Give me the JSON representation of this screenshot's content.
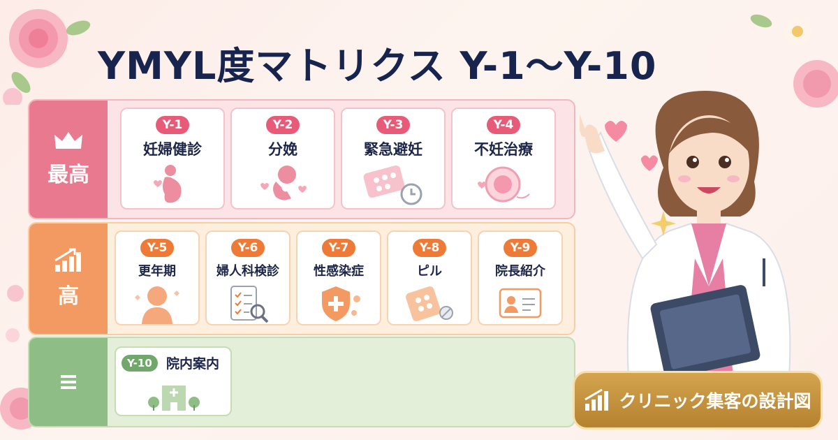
{
  "title": "YMYL度マトリクス Y-1〜Y-10",
  "tiers": {
    "highest": {
      "label": "最高",
      "icon": "crown-icon"
    },
    "high": {
      "label": "高",
      "icon": "rising-bars-icon"
    },
    "medium": {
      "label": "",
      "icon": "equals-icon"
    }
  },
  "cards": {
    "y1": {
      "code": "Y-1",
      "label": "妊婦健診",
      "icon": "pregnant-woman-icon"
    },
    "y2": {
      "code": "Y-2",
      "label": "分娩",
      "icon": "baby-icon"
    },
    "y3": {
      "code": "Y-3",
      "label": "緊急避妊",
      "icon": "pill-pack-clock-icon"
    },
    "y4": {
      "code": "Y-4",
      "label": "不妊治療",
      "icon": "egg-cell-icon"
    },
    "y5": {
      "code": "Y-5",
      "label": "更年期",
      "icon": "woman-silhouette-icon"
    },
    "y6": {
      "code": "Y-6",
      "label": "婦人科検診",
      "icon": "checklist-magnifier-icon"
    },
    "y7": {
      "code": "Y-7",
      "label": "性感染症",
      "icon": "shield-cross-icon"
    },
    "y8": {
      "code": "Y-8",
      "label": "ピル",
      "icon": "pill-pack-icon"
    },
    "y9": {
      "code": "Y-9",
      "label": "院長紹介",
      "icon": "id-card-icon"
    },
    "y10": {
      "code": "Y-10",
      "label": "院内案内",
      "icon": "hospital-icon"
    }
  },
  "brand": {
    "label": "クリニック集客の設計図",
    "icon": "growth-chart-icon"
  },
  "colors": {
    "title": "#17244d",
    "highest_tier": "#e9798f",
    "high_tier": "#f39a62",
    "medium_tier": "#8fbd86",
    "brand_gold": "#c8953e"
  }
}
